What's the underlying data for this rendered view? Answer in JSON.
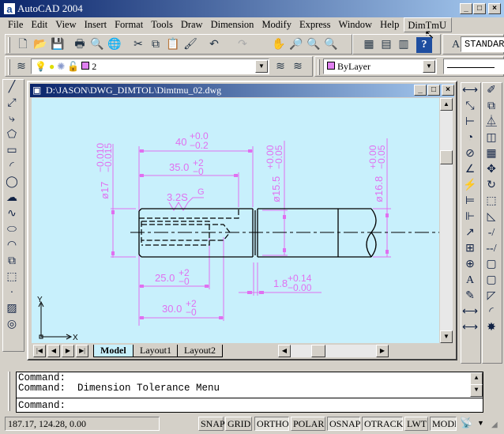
{
  "app": {
    "title": "AutoCAD 2004",
    "icon_letter": "a"
  },
  "menu": [
    "File",
    "Edit",
    "View",
    "Insert",
    "Format",
    "Tools",
    "Draw",
    "Dimension",
    "Modify",
    "Express",
    "Window",
    "Help",
    "DimTmU"
  ],
  "toolbar": {
    "text_style": "STANDAR",
    "layer": "2",
    "color": "ByLayer",
    "layer_color": "#e080f0"
  },
  "drawing": {
    "title": "D:\\JASON\\DWG_DIMTOL\\Dimtmu_02.dwg",
    "canvas_bg": "#c8f0fc",
    "dim_color": "#e070f0",
    "dims": {
      "d40": "40",
      "d40_up": "+0.0",
      "d40_lo": "−0.2",
      "d35": "35.0",
      "d35_up": "+2",
      "d35_lo": "−0",
      "d17": "ø17",
      "d17_up": "−0.010",
      "d17_lo": "−0.015",
      "d155": "ø15.5",
      "d155_up": "+0.00",
      "d155_lo": "−0.05",
      "d168": "ø16.8",
      "d168_up": "+0.00",
      "d168_lo": "−0.05",
      "d25": "25.0",
      "d25_up": "+2",
      "d25_lo": "−0",
      "d30": "30.0",
      "d30_up": "+2",
      "d30_lo": "−0",
      "d18": "1.8",
      "d18_up": "+0.14",
      "d18_lo": "−0.00",
      "surface": "3.2S",
      "surface_g": "G"
    },
    "ucs": {
      "y": "Y",
      "x": "X"
    },
    "tabs": [
      "Model",
      "Layout1",
      "Layout2"
    ],
    "active_tab": "Model"
  },
  "command": {
    "lines": [
      "Command:",
      "Command:  Dimension Tolerance Menu"
    ],
    "prompt": "Command:"
  },
  "status": {
    "coords": "187.17, 124.28, 0.00",
    "buttons": [
      {
        "label": "SNAP",
        "on": false
      },
      {
        "label": "GRID",
        "on": false
      },
      {
        "label": "ORTHO",
        "on": true
      },
      {
        "label": "POLAR",
        "on": false
      },
      {
        "label": "OSNAP",
        "on": true
      },
      {
        "label": "OTRACK",
        "on": true
      },
      {
        "label": "LWT",
        "on": false
      },
      {
        "label": "MODEL",
        "on": true
      }
    ]
  }
}
